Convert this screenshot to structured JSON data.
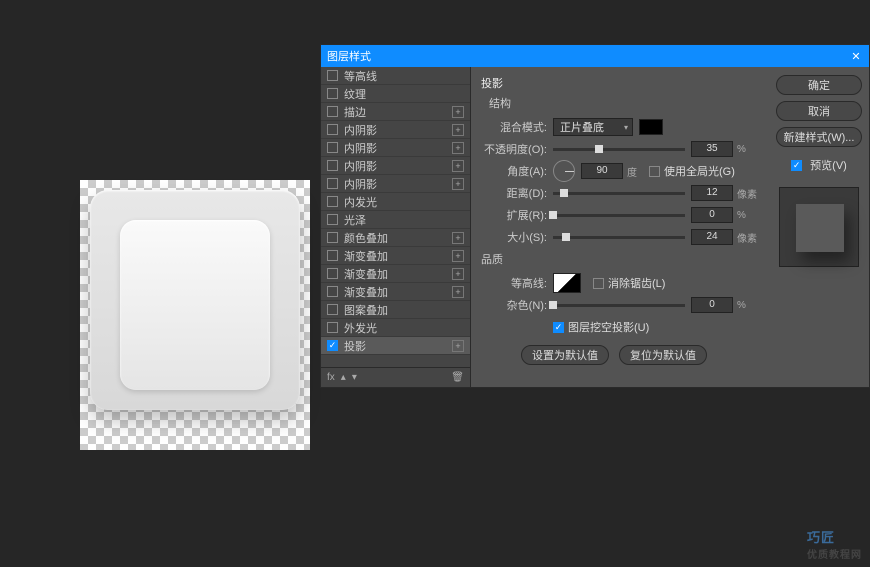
{
  "dialog": {
    "title": "图层样式",
    "close": "✕"
  },
  "effects": [
    {
      "label": "等高线",
      "checked": false,
      "addable": false
    },
    {
      "label": "纹理",
      "checked": false,
      "addable": false
    },
    {
      "label": "描边",
      "checked": false,
      "addable": true
    },
    {
      "label": "内阴影",
      "checked": false,
      "addable": true
    },
    {
      "label": "内阴影",
      "checked": false,
      "addable": true
    },
    {
      "label": "内阴影",
      "checked": false,
      "addable": true
    },
    {
      "label": "内阴影",
      "checked": false,
      "addable": true
    },
    {
      "label": "内发光",
      "checked": false,
      "addable": false
    },
    {
      "label": "光泽",
      "checked": false,
      "addable": false
    },
    {
      "label": "颜色叠加",
      "checked": false,
      "addable": true
    },
    {
      "label": "渐变叠加",
      "checked": false,
      "addable": true
    },
    {
      "label": "渐变叠加",
      "checked": false,
      "addable": true
    },
    {
      "label": "渐变叠加",
      "checked": false,
      "addable": true
    },
    {
      "label": "图案叠加",
      "checked": false,
      "addable": false
    },
    {
      "label": "外发光",
      "checked": false,
      "addable": false
    },
    {
      "label": "投影",
      "checked": true,
      "addable": true,
      "selected": true
    }
  ],
  "footer": {
    "fx": "fx",
    "trash": "🗑"
  },
  "settings": {
    "panel_title": "投影",
    "structure_title": "结构",
    "blend_label": "混合模式:",
    "blend_value": "正片叠底",
    "opacity_label": "不透明度(O):",
    "opacity_value": "35",
    "opacity_unit": "%",
    "angle_label": "角度(A):",
    "angle_value": "90",
    "angle_unit": "度",
    "global_light_label": "使用全局光(G)",
    "distance_label": "距离(D):",
    "distance_value": "12",
    "distance_unit": "像素",
    "spread_label": "扩展(R):",
    "spread_value": "0",
    "spread_unit": "%",
    "size_label": "大小(S):",
    "size_value": "24",
    "size_unit": "像素",
    "quality_title": "品质",
    "contour_label": "等高线:",
    "antialias_label": "消除锯齿(L)",
    "noise_label": "杂色(N):",
    "noise_value": "0",
    "noise_unit": "%",
    "knockout_label": "图层挖空投影(U)",
    "set_default": "设置为默认值",
    "reset_default": "复位为默认值"
  },
  "actions": {
    "ok": "确定",
    "cancel": "取消",
    "new_style": "新建样式(W)...",
    "preview": "预览(V)"
  },
  "watermark": {
    "line1": "巧匠",
    "line2": "优质教程网"
  }
}
